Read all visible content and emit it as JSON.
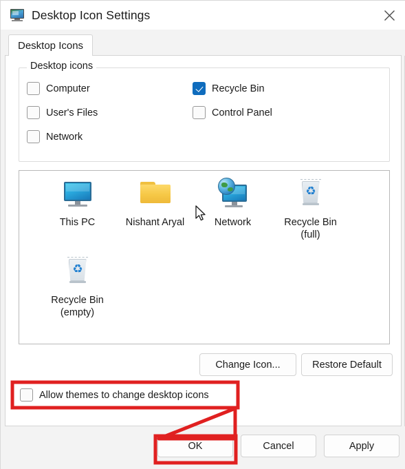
{
  "window": {
    "title": "Desktop Icon Settings",
    "app_icon": "desktop-monitor-icon",
    "close_label": "✕"
  },
  "tabs": [
    {
      "label": "Desktop Icons",
      "selected": true
    }
  ],
  "group": {
    "legend": "Desktop icons",
    "checkboxes": [
      {
        "label": "Computer",
        "checked": false
      },
      {
        "label": "User's Files",
        "checked": false
      },
      {
        "label": "Network",
        "checked": false
      },
      {
        "label": "Recycle Bin",
        "checked": true
      },
      {
        "label": "Control Panel",
        "checked": false
      }
    ]
  },
  "preview": {
    "icons": [
      {
        "caption_line1": "This PC",
        "caption_line2": "",
        "icon": "monitor-icon"
      },
      {
        "caption_line1": "Nishant Aryal",
        "caption_line2": "",
        "icon": "folder-icon"
      },
      {
        "caption_line1": "Network",
        "caption_line2": "",
        "icon": "network-globe-monitor-icon"
      },
      {
        "caption_line1": "Recycle Bin",
        "caption_line2": "(full)",
        "icon": "recycle-bin-full-icon"
      },
      {
        "caption_line1": "Recycle Bin",
        "caption_line2": "(empty)",
        "icon": "recycle-bin-empty-icon"
      }
    ],
    "cursor": "mouse-pointer-icon"
  },
  "actions": {
    "change_icon": "Change Icon...",
    "restore_default": "Restore Default"
  },
  "allow_themes": {
    "label": "Allow themes to change desktop icons",
    "checked": false
  },
  "footer": {
    "ok": "OK",
    "cancel": "Cancel",
    "apply": "Apply"
  },
  "colors": {
    "accent_checkbox": "#0f6cbd",
    "annotation_red": "#e02020",
    "window_bg": "#f3f3f3",
    "page_bg": "#ffffff"
  }
}
